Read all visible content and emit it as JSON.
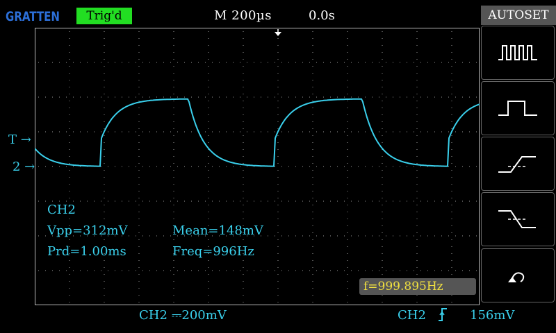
{
  "header": {
    "brand": "GRATTEN",
    "status": "Trig'd",
    "timebase": "M 200µs",
    "trigger_position": "0.0s"
  },
  "markers": {
    "trigger_level": "T →",
    "channel_ground": "2 →"
  },
  "measurements": {
    "channel": "CH2",
    "vpp": "Vpp=312mV",
    "mean": "Mean=148mV",
    "period": "Prd=1.00ms",
    "frequency": "Freq=996Hz",
    "counter": "f=999.895Hz"
  },
  "footer": {
    "channel": "CH2",
    "coupling_scale": "⎓200mV",
    "trigger_channel": "CH2",
    "trigger_edge_icon": "rising-edge-icon",
    "trigger_level": "156mV"
  },
  "menu": {
    "title": "AUTOSET",
    "buttons": [
      {
        "icon": "multi-period-icon"
      },
      {
        "icon": "single-period-icon"
      },
      {
        "icon": "rising-edge-icon"
      },
      {
        "icon": "falling-edge-icon"
      },
      {
        "icon": "undo-icon"
      }
    ]
  },
  "colors": {
    "trace": "#3ad0ec",
    "grid": "#9a9a9a",
    "status_bg": "#22dd22",
    "counter_text": "#f0e040",
    "menu_header_bg": "#555555"
  },
  "waveform": {
    "channel": "CH2",
    "shape": "square-wave-rc-charge-discharge",
    "period_div": 5,
    "low_div": 0,
    "high_div": 1.95,
    "volts_per_div_mV": 200,
    "time_per_div_us": 200
  }
}
